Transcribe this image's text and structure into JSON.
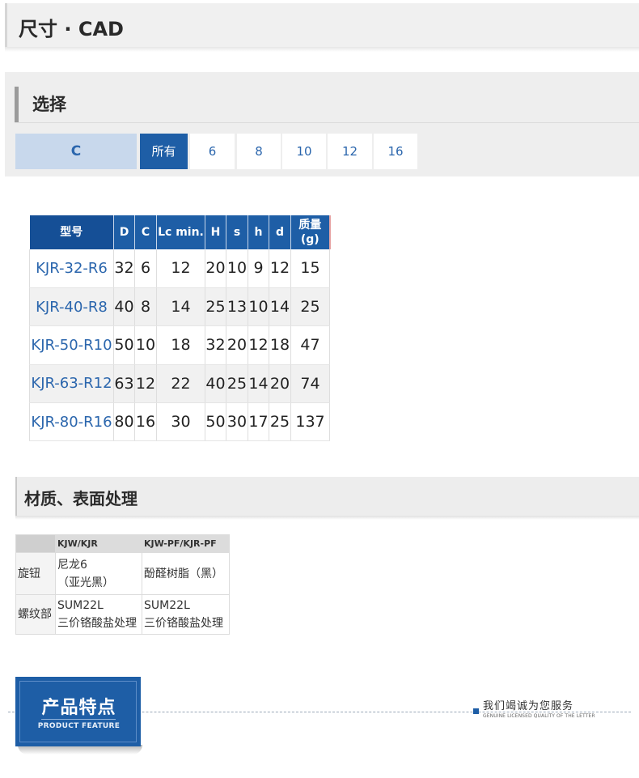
{
  "header": {
    "title": "尺寸 · CAD"
  },
  "selection": {
    "title": "选择",
    "label": "C",
    "options": [
      "所有",
      "6",
      "8",
      "10",
      "12",
      "16"
    ],
    "active_index": 0
  },
  "dimensions": {
    "columns": [
      "型号",
      "D",
      "C",
      "Lc min.",
      "H",
      "s",
      "h",
      "d",
      "质量",
      "(g)"
    ],
    "rows": [
      [
        "KJR-32-R6",
        "32",
        "6",
        "12",
        "20",
        "10",
        "9",
        "12",
        "15"
      ],
      [
        "KJR-40-R8",
        "40",
        "8",
        "14",
        "25",
        "13",
        "10",
        "14",
        "25"
      ],
      [
        "KJR-50-R10",
        "50",
        "10",
        "18",
        "32",
        "20",
        "12",
        "18",
        "47"
      ],
      [
        "KJR-63-R12",
        "63",
        "12",
        "22",
        "40",
        "25",
        "14",
        "20",
        "74"
      ],
      [
        "KJR-80-R16",
        "80",
        "16",
        "30",
        "50",
        "30",
        "17",
        "25",
        "137"
      ]
    ]
  },
  "materials": {
    "title": "材质、表面处理",
    "columns": [
      "KJW/KJR",
      "KJW-PF/KJR-PF"
    ],
    "rows": [
      {
        "name": "旋钮",
        "kjw": [
          "尼龙6",
          "（亚光黑）"
        ],
        "pf": [
          "酚醛树脂（黑）"
        ]
      },
      {
        "name": "螺纹部",
        "kjw": [
          "SUM22L",
          "三价铬酸盐处理"
        ],
        "pf": [
          "SUM22L",
          "三价铬酸盐处理"
        ]
      }
    ]
  },
  "feature": {
    "title_cn": "产品特点",
    "title_en": "PRODUCT FEATURE",
    "service_cn": "我们竭诚为您服务",
    "service_en": "GENUINE LICENSED QUALITY OF THE LETTER"
  },
  "colors": {
    "accent": "#1e5ea6",
    "link": "#2b66ad",
    "panel": "#eeeeee",
    "label_bg": "#c8d8ec"
  }
}
